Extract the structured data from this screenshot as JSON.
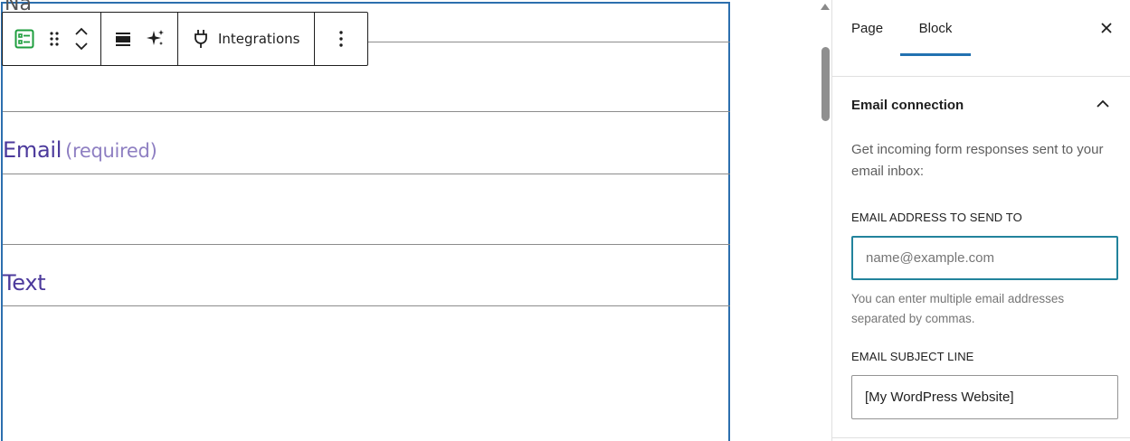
{
  "editor": {
    "hidden_label": "Na",
    "fields": [
      {
        "label": "Email",
        "required_text": "(required)"
      },
      {
        "label": "Text",
        "required_text": ""
      }
    ]
  },
  "toolbar": {
    "block_icon": "form-icon",
    "drag_icon": "drag-handle-icon",
    "move_up_icon": "chevron-up-icon",
    "move_down_icon": "chevron-down-icon",
    "align_icon": "align-wide-icon",
    "ai_icon": "sparkles-icon",
    "integrations_icon": "plug-icon",
    "integrations_label": "Integrations",
    "more_icon": "more-vertical-icon"
  },
  "sidebar": {
    "tabs": [
      {
        "label": "Page"
      },
      {
        "label": "Block"
      }
    ],
    "active_tab": "Block",
    "close_icon": "close-icon",
    "panel": {
      "title": "Email connection",
      "toggle_icon": "chevron-up-icon",
      "description": "Get incoming form responses sent to your email inbox:",
      "email_caption": "EMAIL ADDRESS TO SEND TO",
      "email_placeholder": "name@example.com",
      "email_value": "",
      "email_help": "You can enter multiple email addresses separated by commas.",
      "subject_caption": "EMAIL SUBJECT LINE",
      "subject_value": "[My WordPress Website]"
    }
  },
  "colors": {
    "accent": "#2271b1",
    "field_label": "#4c3a9c",
    "focus_border": "#22839c"
  }
}
